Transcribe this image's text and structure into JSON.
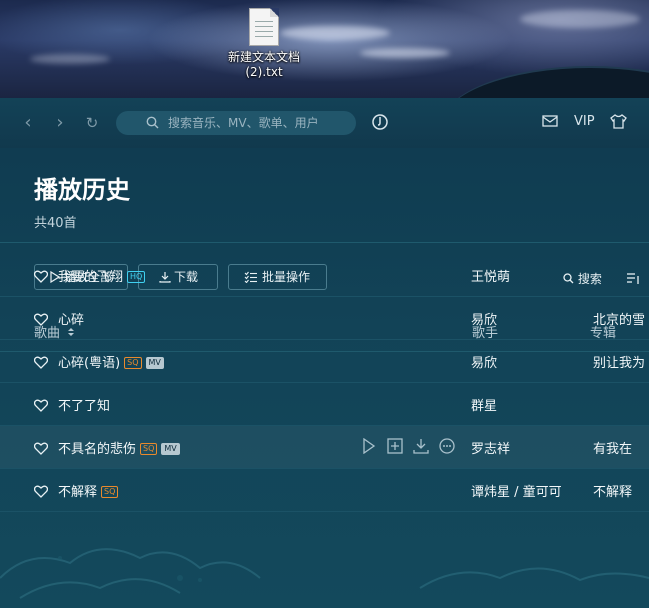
{
  "desktop": {
    "file_icon_label": "新建文本文档 (2).txt"
  },
  "titlebar": {
    "search_placeholder": "搜索音乐、MV、歌单、用户",
    "vip_label": "VIP",
    "icons": [
      "back-icon",
      "forward-icon",
      "refresh-icon",
      "search-icon",
      "listen-recognize-icon",
      "mail-icon",
      "skin-icon"
    ]
  },
  "header": {
    "title": "播放历史",
    "count": "共40首"
  },
  "toolbar": {
    "play_all": "播放全部",
    "download": "下载",
    "batch": "批量操作",
    "search": "搜索"
  },
  "table": {
    "col_song": "歌曲",
    "col_artist": "歌手",
    "col_album": "专辑",
    "rows": [
      {
        "title": "我要的飞翔",
        "tags": [
          "HQ"
        ],
        "artist": "王悦萌",
        "album": ""
      },
      {
        "title": "心碎",
        "tags": [],
        "artist": "易欣",
        "album": "北京的雪"
      },
      {
        "title": "心碎(粤语)",
        "tags": [
          "SQ",
          "MV"
        ],
        "artist": "易欣",
        "album": "别让我为"
      },
      {
        "title": "不了了知",
        "tags": [],
        "artist": "群星",
        "album": ""
      },
      {
        "title": "不具名的悲伤",
        "tags": [
          "SQ",
          "MV"
        ],
        "artist": "罗志祥",
        "album": "有我在"
      },
      {
        "title": "不解释",
        "tags": [
          "SQ"
        ],
        "artist": "谭炜星 / 童可可",
        "album": "不解释"
      }
    ]
  },
  "colors": {
    "background": "#124357",
    "accent_hq": "#3fd0f0",
    "accent_sq": "#e98a2c"
  }
}
